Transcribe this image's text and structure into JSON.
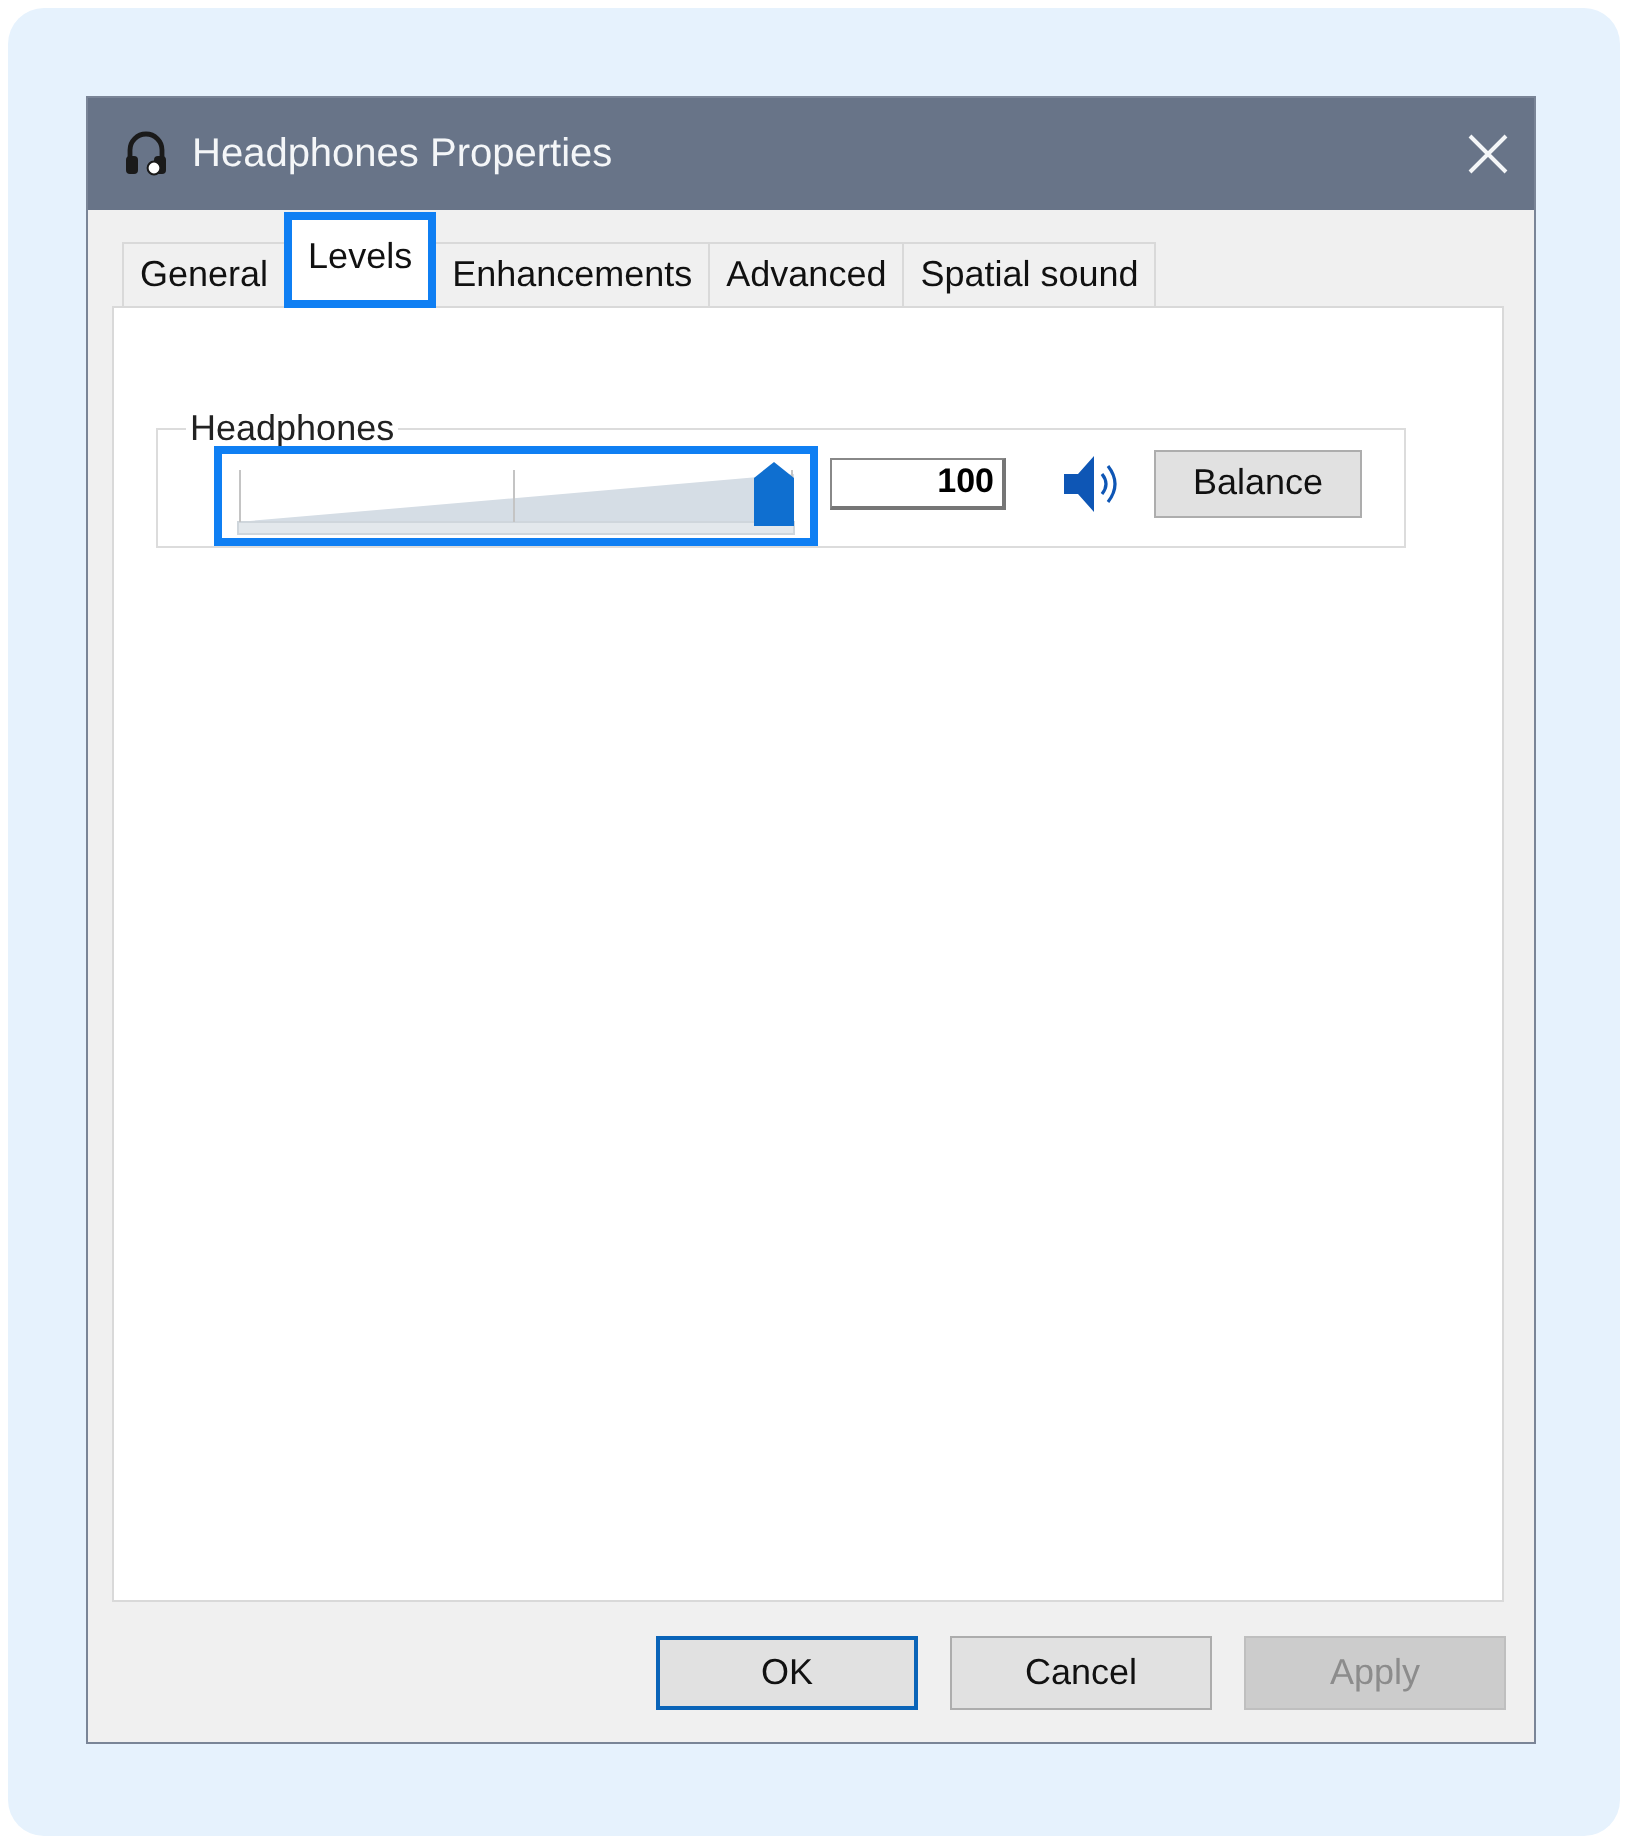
{
  "window": {
    "title": "Headphones Properties"
  },
  "tabs": [
    {
      "label": "General",
      "selected": false,
      "highlighted": false
    },
    {
      "label": "Levels",
      "selected": true,
      "highlighted": true
    },
    {
      "label": "Enhancements",
      "selected": false,
      "highlighted": false
    },
    {
      "label": "Advanced",
      "selected": false,
      "highlighted": false
    },
    {
      "label": "Spatial sound",
      "selected": false,
      "highlighted": false
    }
  ],
  "level_group": {
    "label": "Headphones",
    "slider": {
      "level": 1,
      "highlighted": true
    },
    "value": "100",
    "muted": false,
    "balance_button": "Balance"
  },
  "buttons": [
    {
      "label": "OK",
      "kind": "default",
      "disabled": false
    },
    {
      "label": "Cancel",
      "kind": "normal",
      "disabled": false
    },
    {
      "label": "Apply",
      "kind": "normal",
      "disabled": true
    }
  ]
}
